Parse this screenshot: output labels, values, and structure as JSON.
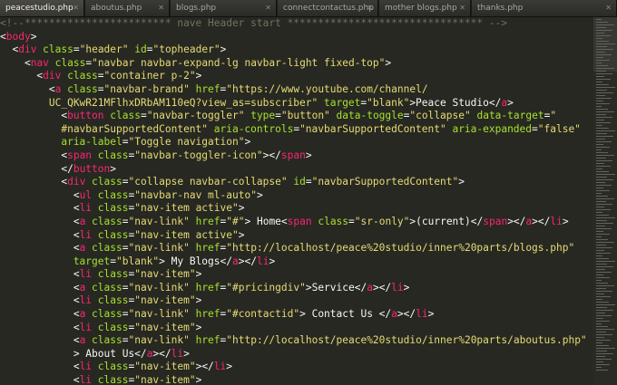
{
  "tabs": [
    {
      "label": "peacestudio.php",
      "active": true
    },
    {
      "label": "aboutus.php",
      "active": false
    },
    {
      "label": "blogs.php",
      "active": false
    },
    {
      "label": "connectcontactus.php",
      "active": false
    },
    {
      "label": "mother blogs.php",
      "active": false
    },
    {
      "label": "thanks.php",
      "active": false
    }
  ],
  "colors": {
    "background": "#272822",
    "tag": "#f92672",
    "attribute": "#a6e22e",
    "string": "#e6db74",
    "comment": "#75715e",
    "text": "#f8f8f2"
  },
  "code_lines": [
    [
      [
        "cmt",
        "<!--************************ nave Header start ******************************** -->"
      ]
    ],
    [
      [
        "txt",
        "<"
      ],
      [
        "tag",
        "body"
      ],
      [
        "txt",
        ">"
      ]
    ],
    [
      [
        "txt",
        "  <"
      ],
      [
        "tag",
        "div"
      ],
      [
        "attr",
        " class"
      ],
      [
        "txt",
        "="
      ],
      [
        "str",
        "\"header\""
      ],
      [
        "attr",
        " id"
      ],
      [
        "txt",
        "="
      ],
      [
        "str",
        "\"topheader\""
      ],
      [
        "txt",
        ">"
      ]
    ],
    [
      [
        "txt",
        "    <"
      ],
      [
        "tag",
        "nav"
      ],
      [
        "attr",
        " class"
      ],
      [
        "txt",
        "="
      ],
      [
        "str",
        "\"navbar navbar-expand-lg navbar-light fixed-top\""
      ],
      [
        "txt",
        ">"
      ]
    ],
    [
      [
        "txt",
        "      <"
      ],
      [
        "tag",
        "div"
      ],
      [
        "attr",
        " class"
      ],
      [
        "txt",
        "="
      ],
      [
        "str",
        "\"container p-2\""
      ],
      [
        "txt",
        ">"
      ]
    ],
    [
      [
        "txt",
        "        <"
      ],
      [
        "tag",
        "a"
      ],
      [
        "attr",
        " class"
      ],
      [
        "txt",
        "="
      ],
      [
        "str",
        "\"navbar-brand\""
      ],
      [
        "attr",
        " href"
      ],
      [
        "txt",
        "="
      ],
      [
        "str",
        "\"https://www.youtube.com/channel/"
      ]
    ],
    [
      [
        "str",
        "        UC_QKwR21MFlhxDRbAM110eQ?view_as=subscriber\""
      ],
      [
        "attr",
        " target"
      ],
      [
        "txt",
        "="
      ],
      [
        "str",
        "\"blank\""
      ],
      [
        "txt",
        ">Peace Studio</"
      ],
      [
        "tag",
        "a"
      ],
      [
        "txt",
        ">"
      ]
    ],
    [
      [
        "txt",
        "          <"
      ],
      [
        "tag",
        "button"
      ],
      [
        "attr",
        " class"
      ],
      [
        "txt",
        "="
      ],
      [
        "str",
        "\"navbar-toggler\""
      ],
      [
        "attr",
        " type"
      ],
      [
        "txt",
        "="
      ],
      [
        "str",
        "\"button\""
      ],
      [
        "attr",
        " data-toggle"
      ],
      [
        "txt",
        "="
      ],
      [
        "str",
        "\"collapse\""
      ],
      [
        "attr",
        " data-target"
      ],
      [
        "txt",
        "="
      ],
      [
        "str",
        "\""
      ]
    ],
    [
      [
        "str",
        "          #navbarSupportedContent\""
      ],
      [
        "attr",
        " aria-controls"
      ],
      [
        "txt",
        "="
      ],
      [
        "str",
        "\"navbarSupportedContent\""
      ],
      [
        "attr",
        " aria-expanded"
      ],
      [
        "txt",
        "="
      ],
      [
        "str",
        "\"false\""
      ]
    ],
    [
      [
        "attr",
        "          aria-label"
      ],
      [
        "txt",
        "="
      ],
      [
        "str",
        "\"Toggle navigation\""
      ],
      [
        "txt",
        ">"
      ]
    ],
    [
      [
        "txt",
        "          <"
      ],
      [
        "tag",
        "span"
      ],
      [
        "attr",
        " class"
      ],
      [
        "txt",
        "="
      ],
      [
        "str",
        "\"navbar-toggler-icon\""
      ],
      [
        "txt",
        "></"
      ],
      [
        "tag",
        "span"
      ],
      [
        "txt",
        ">"
      ]
    ],
    [
      [
        "txt",
        "          </"
      ],
      [
        "tag",
        "button"
      ],
      [
        "txt",
        ">"
      ]
    ],
    [
      [
        "txt",
        "          <"
      ],
      [
        "tag",
        "div"
      ],
      [
        "attr",
        " class"
      ],
      [
        "txt",
        "="
      ],
      [
        "str",
        "\"collapse navbar-collapse\""
      ],
      [
        "attr",
        " id"
      ],
      [
        "txt",
        "="
      ],
      [
        "str",
        "\"navbarSupportedContent\""
      ],
      [
        "txt",
        ">"
      ]
    ],
    [
      [
        "txt",
        "            <"
      ],
      [
        "tag",
        "ul"
      ],
      [
        "attr",
        " class"
      ],
      [
        "txt",
        "="
      ],
      [
        "str",
        "\"navbar-nav ml-auto\""
      ],
      [
        "txt",
        ">"
      ]
    ],
    [
      [
        "txt",
        "            <"
      ],
      [
        "tag",
        "li"
      ],
      [
        "attr",
        " class"
      ],
      [
        "txt",
        "="
      ],
      [
        "str",
        "\"nav-item active\""
      ],
      [
        "txt",
        ">"
      ]
    ],
    [
      [
        "txt",
        "            <"
      ],
      [
        "tag",
        "a"
      ],
      [
        "attr",
        " class"
      ],
      [
        "txt",
        "="
      ],
      [
        "str",
        "\"nav-link\""
      ],
      [
        "attr",
        " href"
      ],
      [
        "txt",
        "="
      ],
      [
        "str",
        "\"#\""
      ],
      [
        "txt",
        "> Home<"
      ],
      [
        "tag",
        "span"
      ],
      [
        "attr",
        " class"
      ],
      [
        "txt",
        "="
      ],
      [
        "str",
        "\"sr-only\""
      ],
      [
        "txt",
        ">(current)</"
      ],
      [
        "tag",
        "span"
      ],
      [
        "txt",
        "></"
      ],
      [
        "tag",
        "a"
      ],
      [
        "txt",
        "></"
      ],
      [
        "tag",
        "li"
      ],
      [
        "txt",
        ">"
      ]
    ],
    [
      [
        "txt",
        "            <"
      ],
      [
        "tag",
        "li"
      ],
      [
        "attr",
        " class"
      ],
      [
        "txt",
        "="
      ],
      [
        "str",
        "\"nav-item active\""
      ],
      [
        "txt",
        ">"
      ]
    ],
    [
      [
        "txt",
        "            <"
      ],
      [
        "tag",
        "a"
      ],
      [
        "attr",
        " class"
      ],
      [
        "txt",
        "="
      ],
      [
        "str",
        "\"nav-link\""
      ],
      [
        "attr",
        " href"
      ],
      [
        "txt",
        "="
      ],
      [
        "str",
        "\"http://localhost/peace%20studio/inner%20parts/blogs.php\""
      ]
    ],
    [
      [
        "attr",
        "            target"
      ],
      [
        "txt",
        "="
      ],
      [
        "str",
        "\"blank\""
      ],
      [
        "txt",
        "> My Blogs</"
      ],
      [
        "tag",
        "a"
      ],
      [
        "txt",
        "></"
      ],
      [
        "tag",
        "li"
      ],
      [
        "txt",
        ">"
      ]
    ],
    [
      [
        "txt",
        "            <"
      ],
      [
        "tag",
        "li"
      ],
      [
        "attr",
        " class"
      ],
      [
        "txt",
        "="
      ],
      [
        "str",
        "\"nav-item\""
      ],
      [
        "txt",
        ">"
      ]
    ],
    [
      [
        "txt",
        "            <"
      ],
      [
        "tag",
        "a"
      ],
      [
        "attr",
        " class"
      ],
      [
        "txt",
        "="
      ],
      [
        "str",
        "\"nav-link\""
      ],
      [
        "attr",
        " href"
      ],
      [
        "txt",
        "="
      ],
      [
        "str",
        "\"#pricingdiv\""
      ],
      [
        "txt",
        ">Service</"
      ],
      [
        "tag",
        "a"
      ],
      [
        "txt",
        "></"
      ],
      [
        "tag",
        "li"
      ],
      [
        "txt",
        ">"
      ]
    ],
    [
      [
        "txt",
        "            <"
      ],
      [
        "tag",
        "li"
      ],
      [
        "attr",
        " class"
      ],
      [
        "txt",
        "="
      ],
      [
        "str",
        "\"nav-item\""
      ],
      [
        "txt",
        ">"
      ]
    ],
    [
      [
        "txt",
        "            <"
      ],
      [
        "tag",
        "a"
      ],
      [
        "attr",
        " class"
      ],
      [
        "txt",
        "="
      ],
      [
        "str",
        "\"nav-link\""
      ],
      [
        "attr",
        " href"
      ],
      [
        "txt",
        "="
      ],
      [
        "str",
        "\"#contactid\""
      ],
      [
        "txt",
        "> Contact Us </"
      ],
      [
        "tag",
        "a"
      ],
      [
        "txt",
        "></"
      ],
      [
        "tag",
        "li"
      ],
      [
        "txt",
        ">"
      ]
    ],
    [
      [
        "txt",
        "            <"
      ],
      [
        "tag",
        "li"
      ],
      [
        "attr",
        " class"
      ],
      [
        "txt",
        "="
      ],
      [
        "str",
        "\"nav-item\""
      ],
      [
        "txt",
        ">"
      ]
    ],
    [
      [
        "txt",
        "            <"
      ],
      [
        "tag",
        "a"
      ],
      [
        "attr",
        " class"
      ],
      [
        "txt",
        "="
      ],
      [
        "str",
        "\"nav-link\""
      ],
      [
        "attr",
        " href"
      ],
      [
        "txt",
        "="
      ],
      [
        "str",
        "\"http://localhost/peace%20studio/inner%20parts/aboutus.php\""
      ]
    ],
    [
      [
        "txt",
        "            > About Us</"
      ],
      [
        "tag",
        "a"
      ],
      [
        "txt",
        "></"
      ],
      [
        "tag",
        "li"
      ],
      [
        "txt",
        ">"
      ]
    ],
    [
      [
        "txt",
        "            <"
      ],
      [
        "tag",
        "li"
      ],
      [
        "attr",
        " class"
      ],
      [
        "txt",
        "="
      ],
      [
        "str",
        "\"nav-item\""
      ],
      [
        "txt",
        "></"
      ],
      [
        "tag",
        "li"
      ],
      [
        "txt",
        ">"
      ]
    ],
    [
      [
        "txt",
        "            <"
      ],
      [
        "tag",
        "li"
      ],
      [
        "attr",
        " class"
      ],
      [
        "txt",
        "="
      ],
      [
        "str",
        "\"nav-item\""
      ],
      [
        "txt",
        ">"
      ]
    ]
  ]
}
